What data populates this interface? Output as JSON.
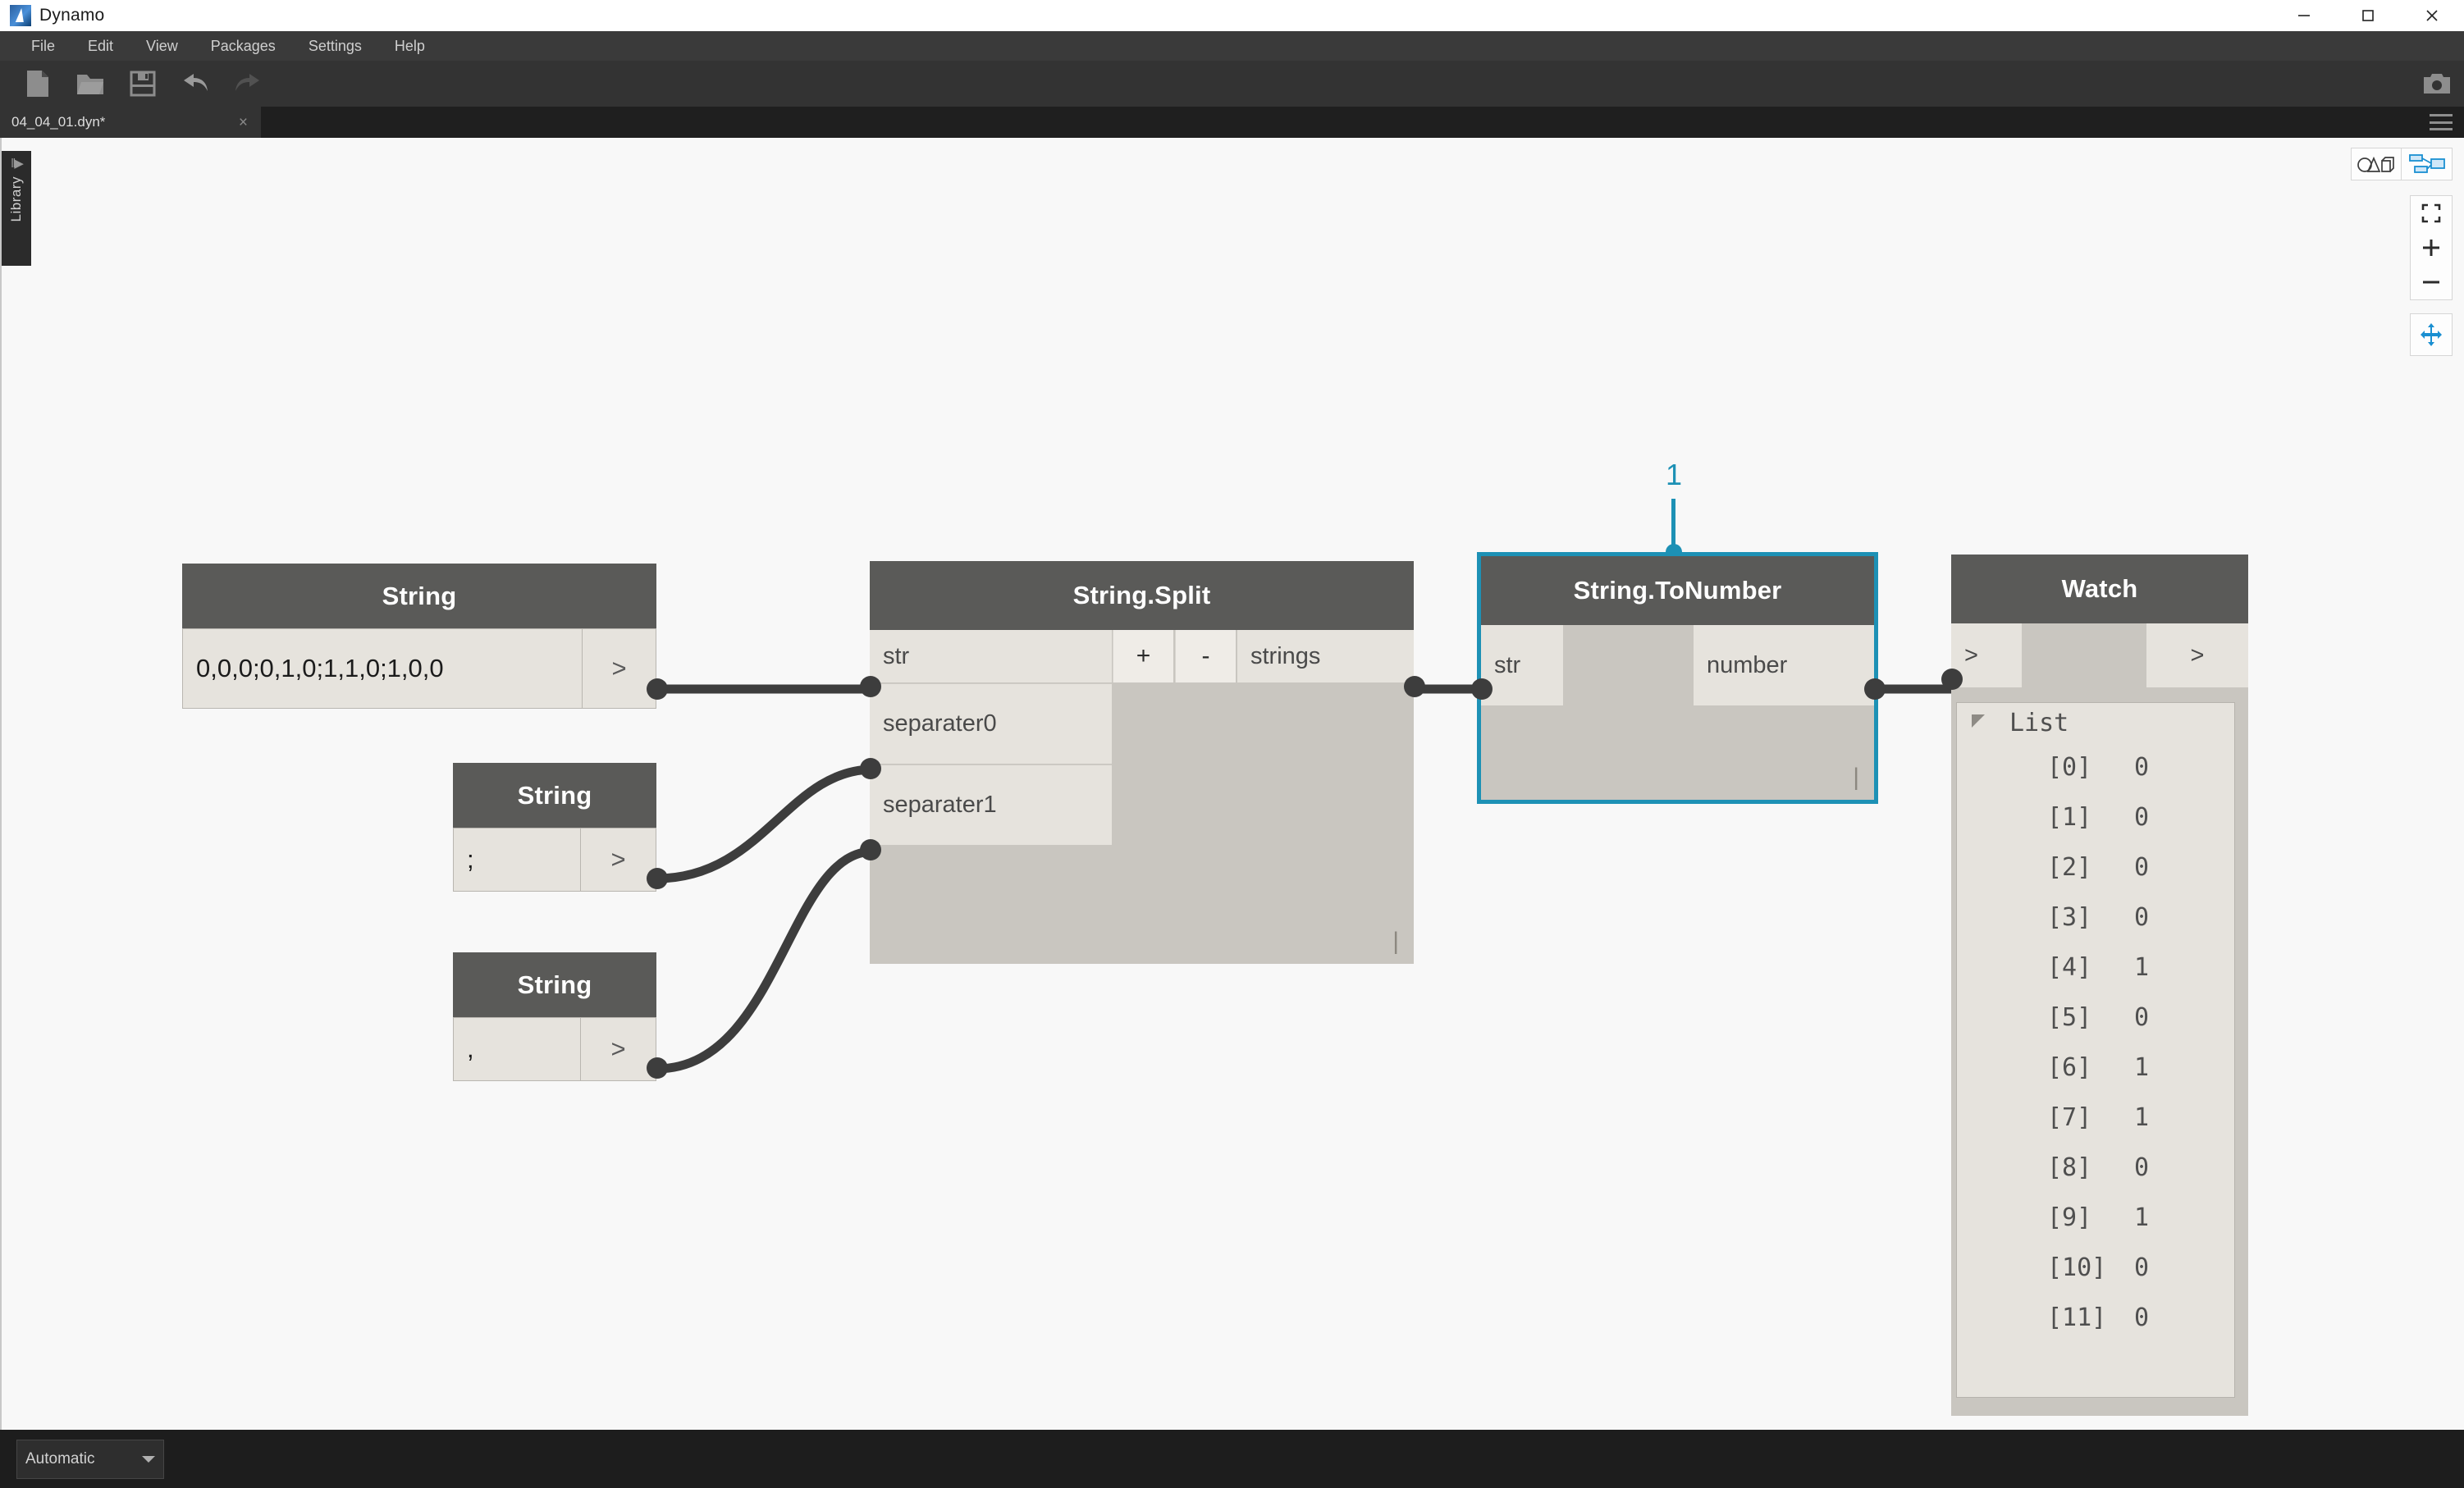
{
  "window": {
    "title": "Dynamo",
    "logo_icon": "dynamo-logo-icon",
    "minimize_icon": "minimize-icon",
    "maximize_icon": "maximize-icon",
    "close_icon": "close-icon"
  },
  "menubar": {
    "items": [
      {
        "label": "File"
      },
      {
        "label": "Edit"
      },
      {
        "label": "View"
      },
      {
        "label": "Packages"
      },
      {
        "label": "Settings"
      },
      {
        "label": "Help"
      }
    ]
  },
  "toolbar": {
    "buttons": [
      {
        "name": "new-file-icon"
      },
      {
        "name": "open-file-icon"
      },
      {
        "name": "save-file-icon"
      },
      {
        "name": "undo-icon"
      },
      {
        "name": "redo-icon"
      }
    ],
    "camera_icon": "camera-icon",
    "hamburger_icon": "hamburger-menu-icon"
  },
  "tabs": {
    "active": {
      "label": "04_04_01.dyn*",
      "close_label": "×"
    }
  },
  "library": {
    "label": "Library",
    "expand_icon": "expand-arrow-icon"
  },
  "view_tools": {
    "geometry_view_icon": "geometry-view-icon",
    "graph_view_icon": "graph-view-icon",
    "zoom_fit_icon": "zoom-to-fit-icon",
    "zoom_in_label": "+",
    "zoom_out_label": "−",
    "pan_icon": "pan-icon"
  },
  "statusbar": {
    "run_mode": "Automatic",
    "run_mode_caret_icon": "chevron-down-icon"
  },
  "colors": {
    "node_header": "#5a5a58",
    "node_body": "#c9c6c0",
    "port": "#e6e3dd",
    "selection": "#1d91b5",
    "wire": "#3d3d3d",
    "canvas": "#f8f8f8"
  },
  "graph": {
    "nodes": [
      {
        "id": "string-input-main",
        "title": "String",
        "value": "0,0,0;0,1,0;1,1,0;1,0,0",
        "output_label": ">"
      },
      {
        "id": "string-input-semicolon",
        "title": "String",
        "value": ";",
        "output_label": ">"
      },
      {
        "id": "string-input-comma",
        "title": "String",
        "value": ",",
        "output_label": ">"
      },
      {
        "id": "string-split",
        "title": "String.Split",
        "inputs": [
          "str",
          "separater0",
          "separater1"
        ],
        "outputs": [
          "strings"
        ],
        "add_port_label": "+",
        "remove_port_label": "-",
        "caret": "|"
      },
      {
        "id": "string-tonumber",
        "title": "String.ToNumber",
        "inputs": [
          "str"
        ],
        "outputs": [
          "number"
        ],
        "selected": true,
        "selection_number": "1",
        "caret": "|"
      },
      {
        "id": "watch",
        "title": "Watch",
        "inputs": [
          ">"
        ],
        "outputs": [
          ">"
        ],
        "list_label": "List",
        "list_items": [
          {
            "index": "[0]",
            "value": "0"
          },
          {
            "index": "[1]",
            "value": "0"
          },
          {
            "index": "[2]",
            "value": "0"
          },
          {
            "index": "[3]",
            "value": "0"
          },
          {
            "index": "[4]",
            "value": "1"
          },
          {
            "index": "[5]",
            "value": "0"
          },
          {
            "index": "[6]",
            "value": "1"
          },
          {
            "index": "[7]",
            "value": "1"
          },
          {
            "index": "[8]",
            "value": "0"
          },
          {
            "index": "[9]",
            "value": "1"
          },
          {
            "index": "[10]",
            "value": "0"
          },
          {
            "index": "[11]",
            "value": "0"
          }
        ]
      }
    ]
  }
}
